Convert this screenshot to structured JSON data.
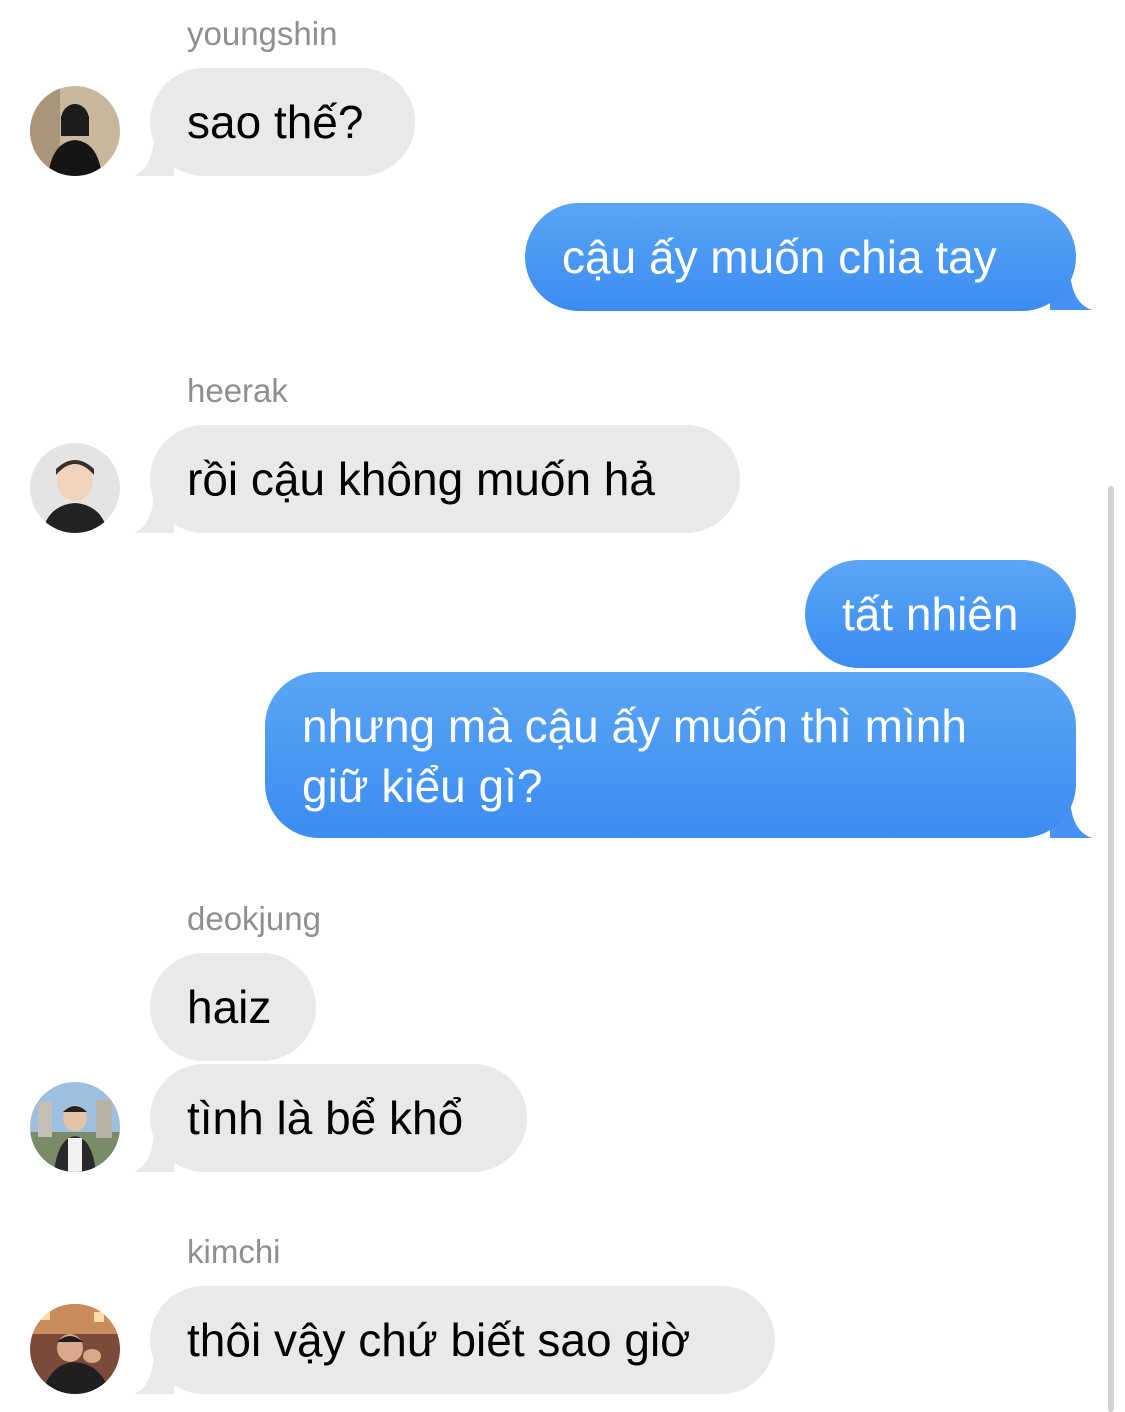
{
  "colors": {
    "incoming_bubble": "#e9e9eb",
    "outgoing_bubble": "#4a97f4",
    "sender_name": "#8e8e93"
  },
  "messages": [
    {
      "sender": "youngshin",
      "text": "sao thế?",
      "avatar": "avatar-youngshin"
    },
    {
      "text": "cậu ấy muốn chia tay"
    },
    {
      "sender": "heerak",
      "text": "rồi cậu không muốn hả",
      "avatar": "avatar-heerak"
    },
    {
      "text": "tất nhiên"
    },
    {
      "line1": "nhưng mà cậu ấy muốn thì mình",
      "line2": "giữ kiểu gì?"
    },
    {
      "sender": "deokjung",
      "text": "haiz"
    },
    {
      "text": "tình là bể khổ",
      "avatar": "avatar-deokjung"
    },
    {
      "sender": "kimchi",
      "text": "thôi vậy chứ biết sao giờ",
      "avatar": "avatar-kimchi"
    }
  ]
}
